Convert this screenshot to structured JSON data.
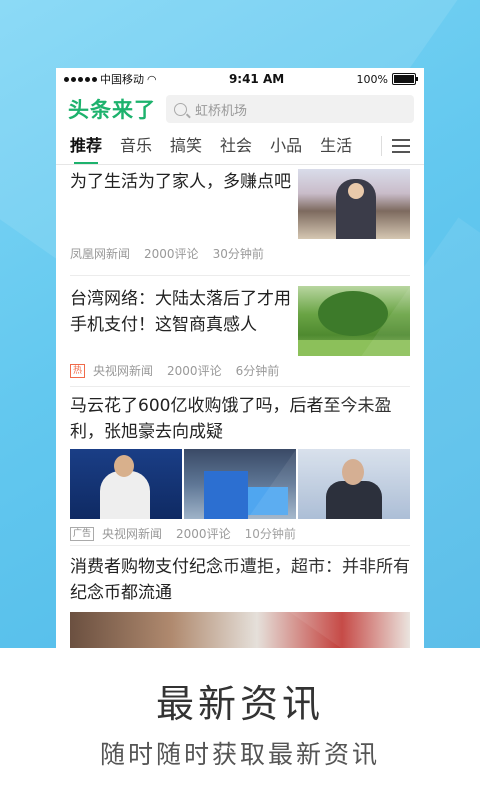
{
  "status_bar": {
    "carrier": "中国移动",
    "time": "9:41 AM",
    "battery": "100%"
  },
  "header": {
    "logo": "头条来了",
    "search_placeholder": "虹桥机场"
  },
  "tabs": [
    {
      "label": "推荐",
      "active": true
    },
    {
      "label": "音乐"
    },
    {
      "label": "搞笑"
    },
    {
      "label": "社会"
    },
    {
      "label": "小品"
    },
    {
      "label": "生活"
    }
  ],
  "news": [
    {
      "title": "为了生活为了家人，多赚点吧",
      "source": "凤凰网新闻",
      "comments": "2000评论",
      "time": "30分钟前"
    },
    {
      "title": "台湾网络：大陆太落后了才用手机支付！这智商真感人",
      "badge": "热",
      "source": "央视网新闻",
      "comments": "2000评论",
      "time": "6分钟前"
    },
    {
      "title": "马云花了600亿收购饿了吗，后者至今未盈利，张旭豪去向成疑",
      "badge": "广告",
      "source": "央视网新闻",
      "comments": "2000评论",
      "time": "10分钟前"
    },
    {
      "title": "消费者购物支付纪念币遭拒，超市：并非所有纪念币都流通"
    }
  ],
  "caption": {
    "title": "最新资讯",
    "subtitle": "随时随时获取最新资讯"
  },
  "colors": {
    "accent": "#1db26d",
    "background": "#63c8ef",
    "hot_badge": "#f06a4a"
  }
}
